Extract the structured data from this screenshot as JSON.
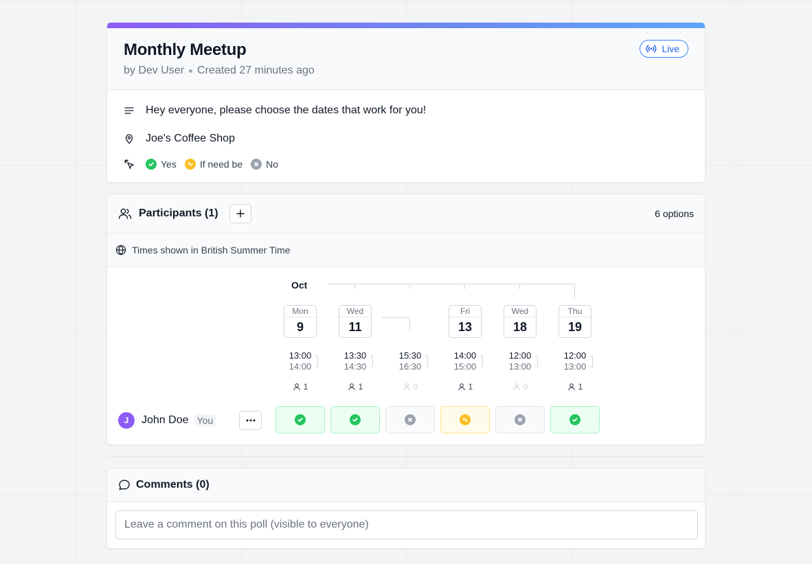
{
  "poll": {
    "title": "Monthly Meetup",
    "author": "by Dev User",
    "created": "Created 27 minutes ago",
    "status": "Live",
    "description": "Hey everyone, please choose the dates that work for you!",
    "location": "Joe's Coffee Shop",
    "legend": {
      "yes": "Yes",
      "maybe": "If need be",
      "no": "No"
    }
  },
  "participants": {
    "title": "Participants (1)",
    "options_count": "6 options",
    "timezone": "Times shown in British Summer Time",
    "month": "Oct",
    "options": [
      {
        "dow": "Mon",
        "day": "9",
        "start": "13:00",
        "end": "14:00",
        "count": "1"
      },
      {
        "dow": "Wed",
        "day": "11",
        "start": "13:30",
        "end": "14:30",
        "count": "1"
      },
      {
        "dow": "",
        "day": "",
        "start": "15:30",
        "end": "16:30",
        "count": "0"
      },
      {
        "dow": "Fri",
        "day": "13",
        "start": "14:00",
        "end": "15:00",
        "count": "1"
      },
      {
        "dow": "Wed",
        "day": "18",
        "start": "12:00",
        "end": "13:00",
        "count": "0"
      },
      {
        "dow": "Thu",
        "day": "19",
        "start": "12:00",
        "end": "13:00",
        "count": "1"
      }
    ],
    "rows": [
      {
        "initial": "J",
        "name": "John Doe",
        "badge": "You",
        "votes": [
          "yes",
          "yes",
          "no",
          "maybe",
          "no",
          "yes"
        ]
      }
    ]
  },
  "comments": {
    "title": "Comments (0)",
    "placeholder": "Leave a comment on this poll (visible to everyone)"
  },
  "colors": {
    "accent_gradient_start": "#8b5cf6",
    "accent_gradient_end": "#60a5fa",
    "yes": "#22c55e",
    "maybe": "#fbbf24",
    "no": "#9ca3af",
    "live": "#2563eb"
  }
}
